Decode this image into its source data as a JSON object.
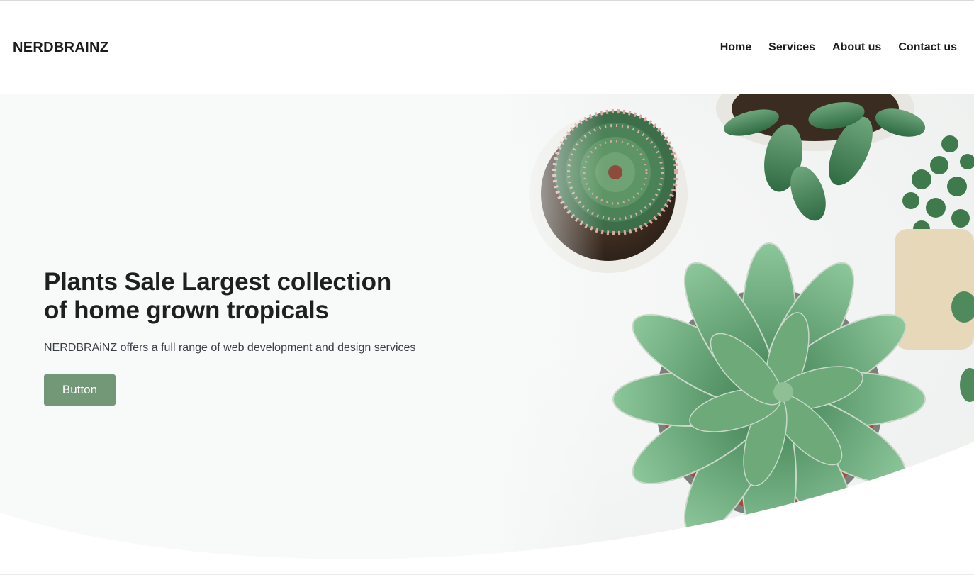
{
  "brand": {
    "logo_text": "NERDBRAINZ"
  },
  "nav": {
    "items": [
      {
        "label": "Home"
      },
      {
        "label": "Services"
      },
      {
        "label": "About us"
      },
      {
        "label": "Contact us"
      }
    ]
  },
  "hero": {
    "title": "Plants Sale Largest collection of home grown tropicals",
    "subtitle": "NERDBRAiNZ offers a full range of web development and design services",
    "button_label": "Button",
    "image_subject": "potted succulents and cactus, top view",
    "colors": {
      "button": "#739878",
      "leaf": "#5b9268",
      "background": "#f7f9f8"
    }
  }
}
